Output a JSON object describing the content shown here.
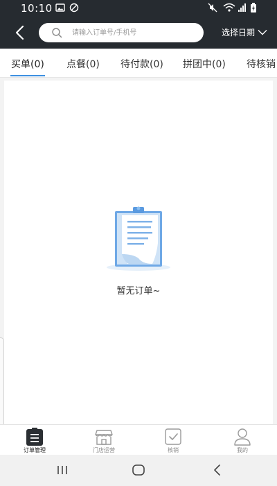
{
  "status_bar": {
    "time": "10:10"
  },
  "header": {
    "search_placeholder": "请输入订单号/手机号",
    "date_label": "选择日期"
  },
  "tabs": [
    {
      "label": "买单(0)"
    },
    {
      "label": "点餐(0)"
    },
    {
      "label": "待付款(0)"
    },
    {
      "label": "拼团中(0)"
    },
    {
      "label": "待核销"
    }
  ],
  "empty_state": {
    "text": "暂无订单~"
  },
  "bottom_tabs": [
    {
      "label": "订单管理"
    },
    {
      "label": "门店运营"
    },
    {
      "label": "核销"
    },
    {
      "label": "我的"
    }
  ],
  "colors": {
    "header_bg": "#262b30",
    "accent": "#3d8fe0"
  }
}
